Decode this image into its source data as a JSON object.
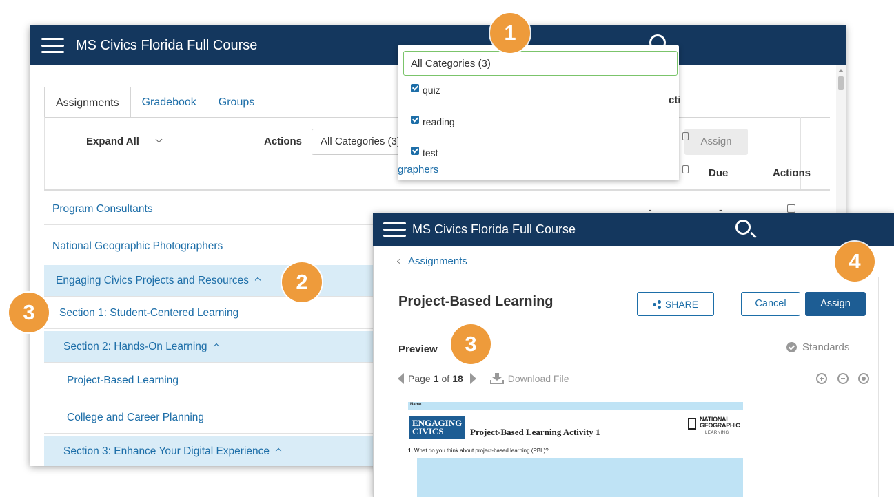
{
  "window_main": {
    "title": "MS Civics Florida Full Course",
    "tabs": [
      {
        "label": "Assignments"
      },
      {
        "label": "Gradebook"
      },
      {
        "label": "Groups"
      }
    ],
    "toolbar": {
      "expand_all": "Expand All",
      "actions_label": "Actions",
      "category_select_value": "All Categories (3)",
      "assign_label": "Assign"
    },
    "columns": {
      "due": "Due",
      "actions": "Actions"
    },
    "rows": [
      {
        "label": "Program Consultants",
        "dash1": "-",
        "dash2": "-"
      },
      {
        "label": "National Geographic Photographers"
      },
      {
        "label": "Engaging Civics Projects and Resources"
      },
      {
        "label": "Section 1: Student-Centered Learning"
      },
      {
        "label": "Section 2: Hands-On Learning"
      },
      {
        "label": "Project-Based Learning"
      },
      {
        "label": "College and Career Planning"
      },
      {
        "label": "Section 3: Enhance Your Digital Experience"
      }
    ]
  },
  "category_dropdown": {
    "header": "All Categories (3)",
    "options": [
      {
        "label": "quiz",
        "checked": true
      },
      {
        "label": "reading",
        "checked": true
      },
      {
        "label": "test",
        "checked": true
      }
    ],
    "peek_text_right": "cti",
    "peek_text_bottom": "graphers"
  },
  "window_preview": {
    "title": "MS Civics Florida Full Course",
    "breadcrumb": "Assignments",
    "doc_title": "Project-Based Learning",
    "share_label": "SHARE",
    "cancel_label": "Cancel",
    "assign_label": "Assign",
    "preview_label": "Preview",
    "standards_label": "Standards",
    "pager": {
      "prefix": "Page",
      "current": "1",
      "of": "of",
      "total": "18"
    },
    "download_label": "Download File",
    "document": {
      "name_label": "Name",
      "logo_line1": "ENGAGING",
      "logo_line2": "CIVICS",
      "activity_title": "Project-Based Learning Activity 1",
      "publisher_line1": "NATIONAL",
      "publisher_line2": "GEOGRAPHIC",
      "publisher_line3": "LEARNING",
      "question_number": "1.",
      "question": "What do you think about project-based learning (PBL)?"
    }
  },
  "callouts": {
    "one": "1",
    "two": "2",
    "three_a": "3",
    "three_b": "3",
    "four": "4"
  },
  "colors": {
    "topbar": "#14375e",
    "link": "#1d6ea8",
    "highlight_row": "#d9ecf7",
    "callout": "#ee9b3b",
    "primary_button": "#1d5d94"
  }
}
